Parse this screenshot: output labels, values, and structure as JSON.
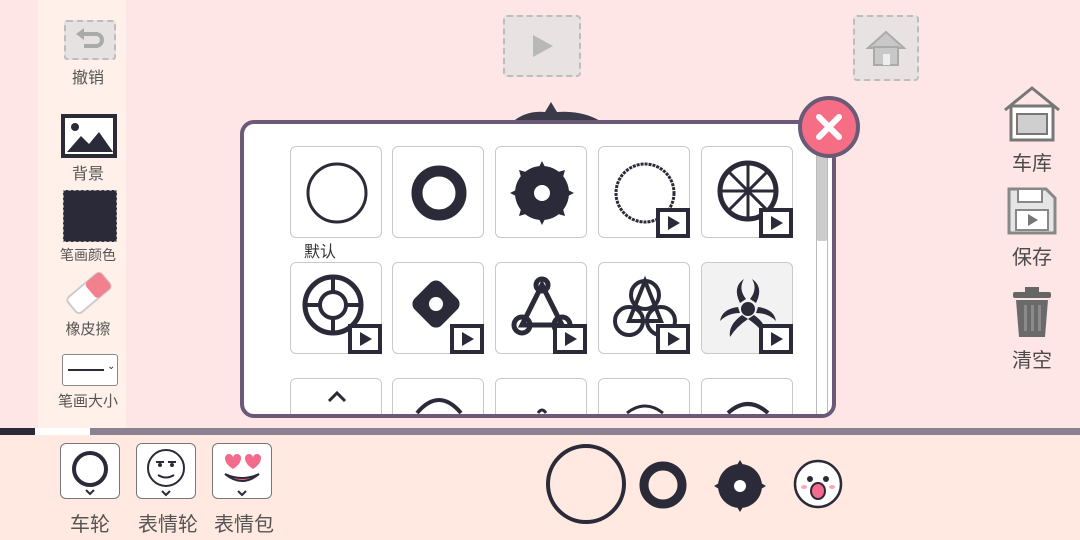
{
  "left_toolbar": {
    "undo_label": "撤销",
    "background_label": "背景",
    "stroke_color_label": "笔画颜色",
    "stroke_color": "#2b2a38",
    "eraser_label": "橡皮擦",
    "stroke_size_label": "笔画大小"
  },
  "right_toolbar": {
    "garage_label": "车库",
    "save_label": "保存",
    "clear_label": "清空"
  },
  "wheel_panel": {
    "default_label": "默认",
    "items": [
      {
        "name": "round-thin",
        "video": false
      },
      {
        "name": "round-thick",
        "video": false
      },
      {
        "name": "spiked",
        "video": false
      },
      {
        "name": "thorny-ring",
        "video": true
      },
      {
        "name": "spoked",
        "video": true
      },
      {
        "name": "crosshair",
        "video": true
      },
      {
        "name": "diamond",
        "video": true
      },
      {
        "name": "triangle-knot",
        "video": true
      },
      {
        "name": "triple-ring",
        "video": true
      },
      {
        "name": "radiation",
        "video": true
      }
    ]
  },
  "bottom_bar": {
    "wheel_tab": "车轮",
    "emoji_wheel_tab": "表情轮",
    "sticker_tab": "表情包"
  },
  "colors": {
    "background": "#ffe6e6",
    "ink": "#2b2a38",
    "panel_border": "#6a5a78",
    "close_button": "#f56e86"
  }
}
